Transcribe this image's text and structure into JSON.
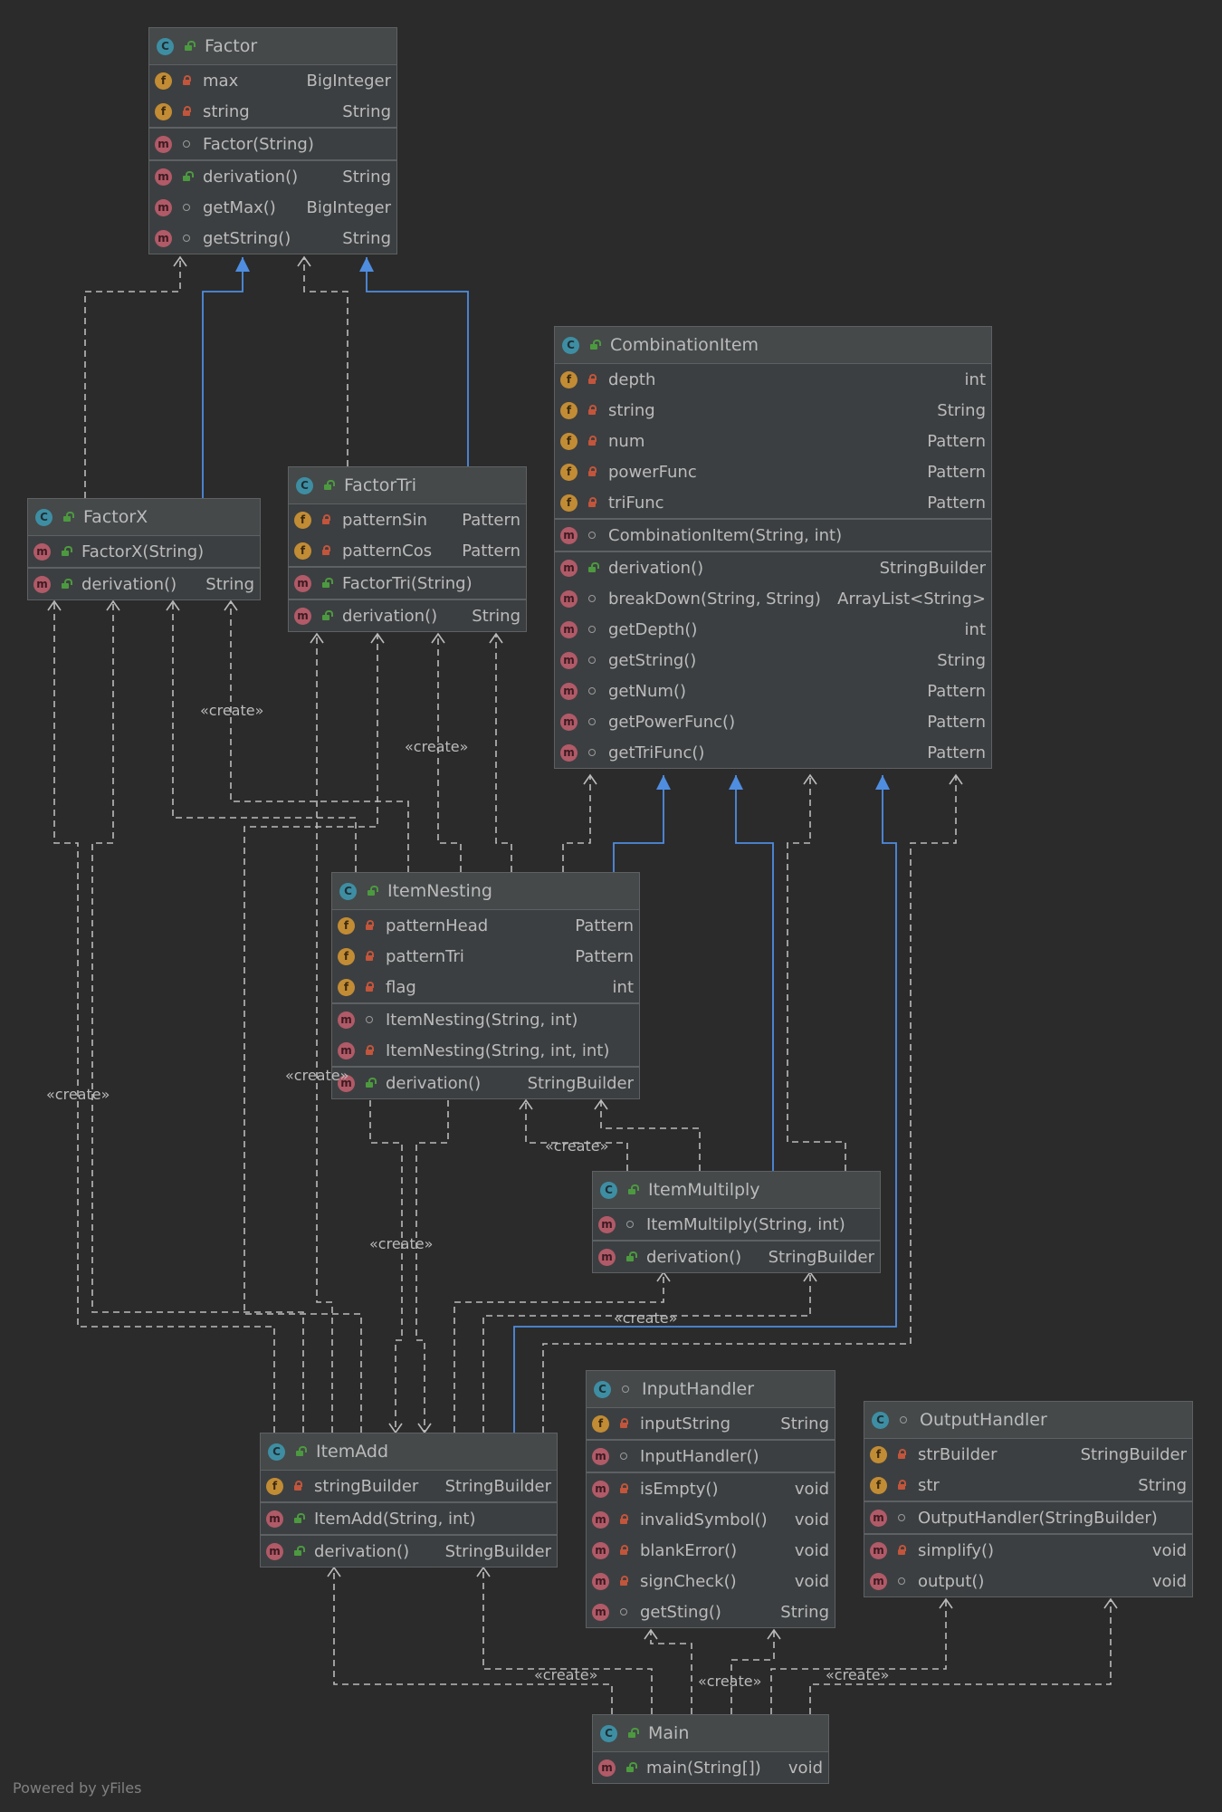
{
  "diagram": {
    "watermark": "Powered by yFiles",
    "stereotype": "«create»",
    "colors": {
      "background": "#2b2b2b",
      "edge": "#bbbbbb",
      "inheritance": "#4f8de0"
    }
  },
  "classes": {
    "factor": {
      "name": "Factor",
      "fields": [
        {
          "name": "max",
          "type": "BigInteger"
        },
        {
          "name": "string",
          "type": "String"
        }
      ],
      "constructors": [
        {
          "name": "Factor(String)",
          "type": ""
        }
      ],
      "methods": [
        {
          "name": "derivation()",
          "type": "String"
        },
        {
          "name": "getMax()",
          "type": "BigInteger"
        },
        {
          "name": "getString()",
          "type": "String"
        }
      ]
    },
    "combination_item": {
      "name": "CombinationItem",
      "fields": [
        {
          "name": "depth",
          "type": "int"
        },
        {
          "name": "string",
          "type": "String"
        },
        {
          "name": "num",
          "type": "Pattern"
        },
        {
          "name": "powerFunc",
          "type": "Pattern"
        },
        {
          "name": "triFunc",
          "type": "Pattern"
        }
      ],
      "constructors": [
        {
          "name": "CombinationItem(String, int)",
          "type": ""
        }
      ],
      "methods": [
        {
          "name": "derivation()",
          "type": "StringBuilder"
        },
        {
          "name": "breakDown(String, String)",
          "type": "ArrayList<String>"
        },
        {
          "name": "getDepth()",
          "type": "int"
        },
        {
          "name": "getString()",
          "type": "String"
        },
        {
          "name": "getNum()",
          "type": "Pattern"
        },
        {
          "name": "getPowerFunc()",
          "type": "Pattern"
        },
        {
          "name": "getTriFunc()",
          "type": "Pattern"
        }
      ]
    },
    "factor_x": {
      "name": "FactorX",
      "constructors": [
        {
          "name": "FactorX(String)",
          "type": ""
        }
      ],
      "methods": [
        {
          "name": "derivation()",
          "type": "String"
        }
      ]
    },
    "factor_tri": {
      "name": "FactorTri",
      "fields": [
        {
          "name": "patternSin",
          "type": "Pattern"
        },
        {
          "name": "patternCos",
          "type": "Pattern"
        }
      ],
      "constructors": [
        {
          "name": "FactorTri(String)",
          "type": ""
        }
      ],
      "methods": [
        {
          "name": "derivation()",
          "type": "String"
        }
      ]
    },
    "item_nesting": {
      "name": "ItemNesting",
      "fields": [
        {
          "name": "patternHead",
          "type": "Pattern"
        },
        {
          "name": "patternTri",
          "type": "Pattern"
        },
        {
          "name": "flag",
          "type": "int"
        }
      ],
      "constructors": [
        {
          "name": "ItemNesting(String, int)",
          "type": ""
        },
        {
          "name": "ItemNesting(String, int, int)",
          "type": ""
        }
      ],
      "methods": [
        {
          "name": "derivation()",
          "type": "StringBuilder"
        }
      ]
    },
    "item_multiply": {
      "name": "ItemMultilply",
      "constructors": [
        {
          "name": "ItemMultilply(String, int)",
          "type": ""
        }
      ],
      "methods": [
        {
          "name": "derivation()",
          "type": "StringBuilder"
        }
      ]
    },
    "item_add": {
      "name": "ItemAdd",
      "fields": [
        {
          "name": "stringBuilder",
          "type": "StringBuilder"
        }
      ],
      "constructors": [
        {
          "name": "ItemAdd(String, int)",
          "type": ""
        }
      ],
      "methods": [
        {
          "name": "derivation()",
          "type": "StringBuilder"
        }
      ]
    },
    "input_handler": {
      "name": "InputHandler",
      "fields": [
        {
          "name": "inputString",
          "type": "String"
        }
      ],
      "constructors": [
        {
          "name": "InputHandler()",
          "type": ""
        }
      ],
      "methods": [
        {
          "name": "isEmpty()",
          "type": "void"
        },
        {
          "name": "invalidSymbol()",
          "type": "void"
        },
        {
          "name": "blankError()",
          "type": "void"
        },
        {
          "name": "signCheck()",
          "type": "void"
        },
        {
          "name": "getSting()",
          "type": "String"
        }
      ]
    },
    "output_handler": {
      "name": "OutputHandler",
      "fields": [
        {
          "name": "strBuilder",
          "type": "StringBuilder"
        },
        {
          "name": "str",
          "type": "String"
        }
      ],
      "constructors": [
        {
          "name": "OutputHandler(StringBuilder)",
          "type": ""
        }
      ],
      "methods": [
        {
          "name": "simplify()",
          "type": "void"
        },
        {
          "name": "output()",
          "type": "void"
        }
      ]
    },
    "main": {
      "name": "Main",
      "methods": [
        {
          "name": "main(String[])",
          "type": "void"
        }
      ]
    }
  }
}
